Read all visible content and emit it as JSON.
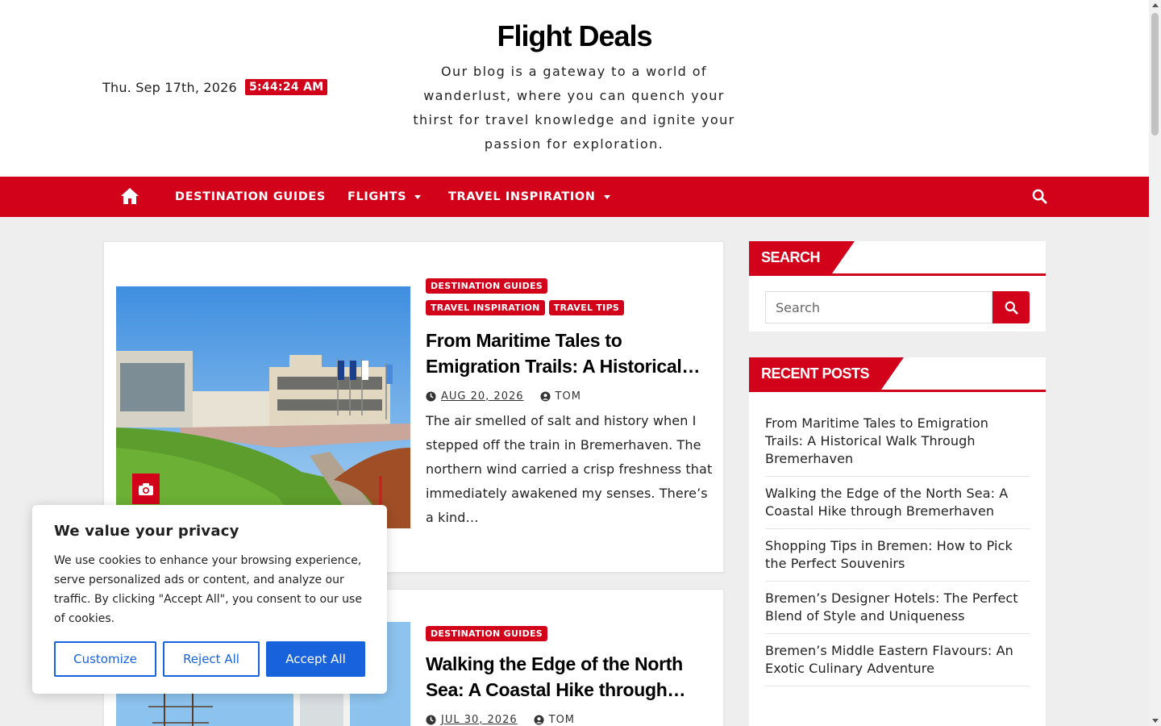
{
  "header": {
    "date": "Thu. Sep 17th, 2026",
    "time": "5:44:24 AM",
    "site_title": "Flight Deals",
    "tagline": "Our blog is a gateway to a world of wanderlust, where you can quench your thirst for travel knowledge and ignite your passion for exploration."
  },
  "nav": {
    "items": [
      {
        "label": "DESTINATION GUIDES"
      },
      {
        "label": "FLIGHTS"
      },
      {
        "label": "TRAVEL INSPIRATION"
      }
    ]
  },
  "posts": [
    {
      "categories": [
        "DESTINATION GUIDES",
        "TRAVEL INSPIRATION",
        "TRAVEL TIPS"
      ],
      "title": "From Maritime Tales to Emigration Trails: A Historical…",
      "date": "AUG 20, 2026",
      "author": "TOM",
      "excerpt": "The air smelled of salt and history when I stepped off the train in Bremerhaven. The northern wind carried a crisp freshness that immediately awakened my senses. There’s a kind…"
    },
    {
      "categories": [
        "DESTINATION GUIDES"
      ],
      "title": "Walking the Edge of the North Sea: A Coastal Hike through…",
      "date": "JUL 30, 2026",
      "author": "TOM"
    }
  ],
  "sidebar": {
    "search_title": "SEARCH",
    "search_placeholder": "Search",
    "recent_title": "RECENT POSTS",
    "recent": [
      "From Maritime Tales to Emigration Trails: A Historical Walk Through Bremerhaven",
      "Walking the Edge of the North Sea: A Coastal Hike through Bremerhaven",
      "Shopping Tips in Bremen: How to Pick the Perfect Souvenirs",
      "Bremen’s Designer Hotels: The Perfect Blend of Style and Uniqueness",
      "Bremen’s Middle Eastern Flavours: An Exotic Culinary Adventure"
    ]
  },
  "cookie": {
    "title": "We value your privacy",
    "text": "We use cookies to enhance your browsing experience, serve personalized ads or content, and analyze our traffic. By clicking \"Accept All\", you consent to our use of cookies.",
    "customize": "Customize",
    "reject": "Reject All",
    "accept": "Accept All"
  },
  "colors": {
    "accent": "#d3021b",
    "cookie_blue": "#1863dc"
  },
  "icons": [
    "home-icon",
    "search-icon",
    "camera-icon",
    "clock-icon",
    "user-icon"
  ]
}
